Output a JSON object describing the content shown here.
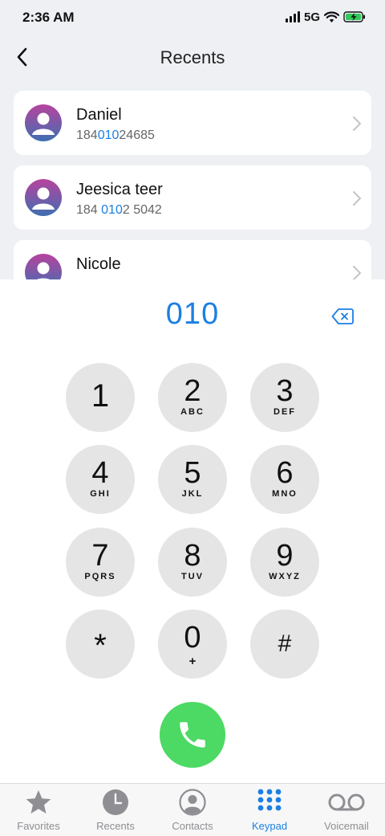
{
  "status_bar": {
    "time": "2:36 AM",
    "network": "5G"
  },
  "header": {
    "title": "Recents"
  },
  "recents": [
    {
      "name": "Daniel",
      "number_parts": [
        "184",
        "010",
        "24685"
      ]
    },
    {
      "name": "Jeesica teer",
      "number_parts": [
        "184 ",
        "010",
        "2 5042"
      ]
    },
    {
      "name": "Nicole",
      "number_parts": [
        "",
        "",
        ""
      ]
    }
  ],
  "dialer": {
    "display": "010",
    "keys": [
      {
        "digit": "1",
        "letters": ""
      },
      {
        "digit": "2",
        "letters": "ABC"
      },
      {
        "digit": "3",
        "letters": "DEF"
      },
      {
        "digit": "4",
        "letters": "GHI"
      },
      {
        "digit": "5",
        "letters": "JKL"
      },
      {
        "digit": "6",
        "letters": "MNO"
      },
      {
        "digit": "7",
        "letters": "PQRS"
      },
      {
        "digit": "8",
        "letters": "TUV"
      },
      {
        "digit": "9",
        "letters": "WXYZ"
      },
      {
        "digit": "*",
        "letters": ""
      },
      {
        "digit": "0",
        "letters": "+"
      },
      {
        "digit": "#",
        "letters": ""
      }
    ]
  },
  "tabs": [
    {
      "label": "Favorites",
      "icon": "star-icon"
    },
    {
      "label": "Recents",
      "icon": "clock-icon"
    },
    {
      "label": "Contacts",
      "icon": "person-circle-icon"
    },
    {
      "label": "Keypad",
      "icon": "keypad-icon",
      "active": true
    },
    {
      "label": "Voicemail",
      "icon": "voicemail-icon"
    }
  ],
  "colors": {
    "accent": "#1b7fe3",
    "call": "#4cd964",
    "key": "#e5e5e5",
    "battery": "#34c759"
  }
}
